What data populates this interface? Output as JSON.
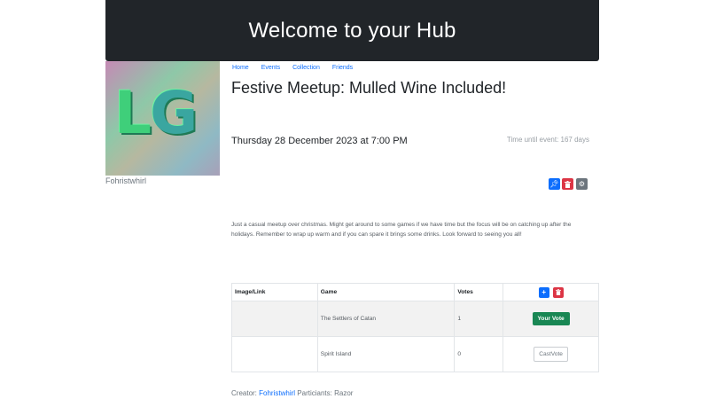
{
  "header": {
    "title": "Welcome to your Hub"
  },
  "profile": {
    "avatar_letters": "LG",
    "username": "Fohristwhirl"
  },
  "nav": {
    "items": [
      "Home",
      "Events",
      "Collection",
      "Friends"
    ]
  },
  "event": {
    "title": "Festive Meetup: Mulled Wine Included!",
    "date": "Thursday 28 December 2023 at 7:00 PM",
    "countdown": "Time until event: 167 days",
    "description": "Just a casual meetup over christmas. Might get around to some games if we have time but the focus will be on catching up after the holidays. Remember to wrap up warm and if you can spare it brings some drinks. Look forward to seeing you all!"
  },
  "actions": {
    "pin_icon": "pin-icon",
    "delete_icon": "trash-icon",
    "settings_icon": "gear-icon"
  },
  "games_table": {
    "headers": [
      "Image/Link",
      "Game",
      "Votes"
    ],
    "rows": [
      {
        "image": "",
        "game": "The Settlers of Catan",
        "votes": "1",
        "action": "Your Vote"
      },
      {
        "image": "",
        "game": "Spirit Island",
        "votes": "0",
        "action": "CastVote"
      }
    ]
  },
  "footer": {
    "creator_label": "Creator:",
    "creator": "Fohristwhirl",
    "participants_label": "Particiants:",
    "participants": "Razor"
  },
  "colors": {
    "primary": "#0d6efd",
    "danger": "#dc3545",
    "success": "#198754",
    "secondary": "#6c757d",
    "dark": "#212529"
  }
}
